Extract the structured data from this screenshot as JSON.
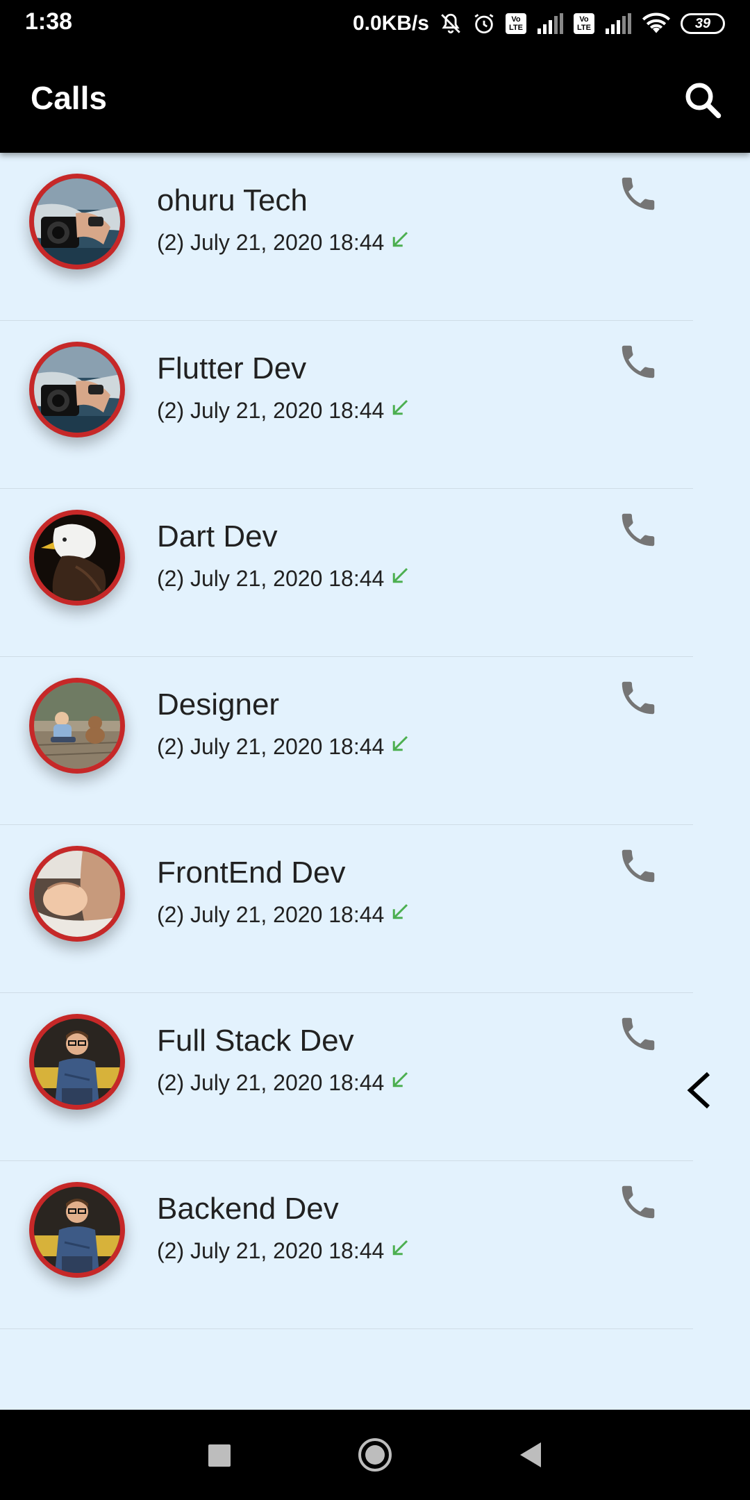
{
  "status_bar": {
    "time": "1:38",
    "net_speed": "0.0KB/s",
    "battery": "39",
    "volte_label_top": "Vo",
    "volte_label_bottom": "LTE"
  },
  "app_bar": {
    "title": "Calls"
  },
  "calls": [
    {
      "name": "ohuru Tech",
      "info": "(2) July 21, 2020 18:44",
      "avatar": "hands-camera"
    },
    {
      "name": "Flutter Dev",
      "info": "(2) July 21, 2020 18:44",
      "avatar": "hands-camera"
    },
    {
      "name": "Dart Dev",
      "info": "(2) July 21, 2020 18:44",
      "avatar": "eagle"
    },
    {
      "name": "Designer",
      "info": "(2) July 21, 2020 18:44",
      "avatar": "child-teddy"
    },
    {
      "name": "FrontEnd Dev",
      "info": "(2) July 21, 2020 18:44",
      "avatar": "baby"
    },
    {
      "name": "Full Stack Dev",
      "info": "(2) July 21, 2020 18:44",
      "avatar": "man-glasses"
    },
    {
      "name": "Backend Dev",
      "info": "(2) July 21, 2020 18:44",
      "avatar": "man-glasses"
    }
  ],
  "colors": {
    "background": "#e3f2fd",
    "app_bar": "#000000",
    "avatar_ring": "#c62828",
    "incoming_arrow": "#4caf50",
    "call_icon": "#757575",
    "text": "#212121"
  }
}
